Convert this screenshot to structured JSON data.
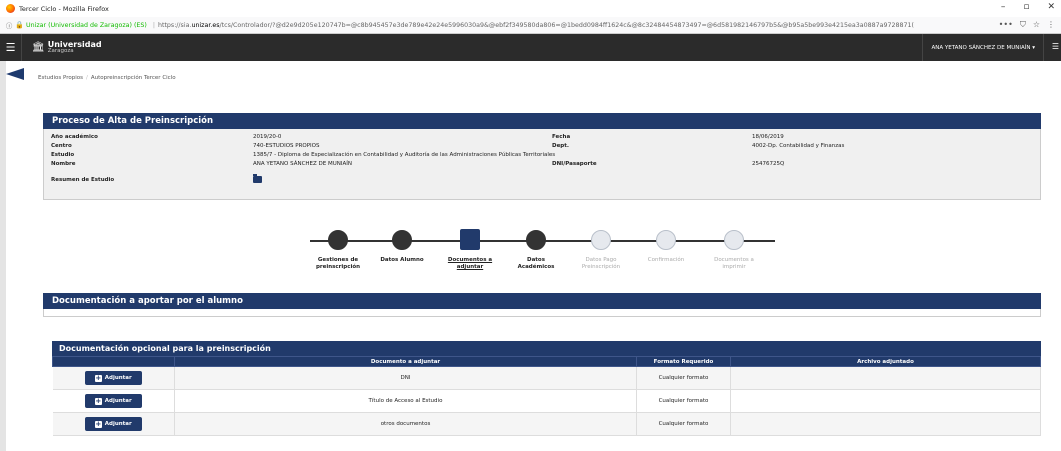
{
  "browser": {
    "window_title": "Tercer Ciclo - Mozilla Firefox",
    "site_identity": "Unizar (Universidad de Zaragoza) (ES)",
    "url_prefix": "https://sia.",
    "url_domain": "unizar.es",
    "url_rest": "/tcs/Controlador/?@d2e9d205e120747b=@c8b945457e3de789e42e24e5996030a9&@ebf2f349580da806=@1bedd0984ff1624c&@8c32484454873497=@6d581982146797b5&@b95a5be993e4215ea3a0887a9728871(",
    "minimize_glyph": "–",
    "maximize_glyph": "▫",
    "close_glyph": "✕"
  },
  "app": {
    "logo_line1": "Universidad",
    "logo_line2": "Zaragoza",
    "user_name": "ANA YETANO SÁNCHEZ DE MUNIAÍN ▾"
  },
  "breadcrumb": [
    "Estudios Propios",
    "Autopreinscripción Tercer Ciclo"
  ],
  "proceso": {
    "title": "Proceso de Alta de Preinscripción",
    "labels": {
      "anio": "Año académico",
      "centro": "Centro",
      "estudio": "Estudio",
      "nombre": "Nombre",
      "resumen": "Resumen de Estudio",
      "fecha": "Fecha",
      "dept": "Dept.",
      "dni": "DNI/Pasaporte"
    },
    "values": {
      "anio": "2019/20-0",
      "centro": "740-ESTUDIOS PROPIOS",
      "estudio": "1385/7 - Diploma de Especialización en Contabilidad y Auditoría de las Administraciones Públicas Territoriales",
      "nombre": "ANA YETANO SÁNCHEZ DE MUNIAÍN",
      "fecha": "18/06/2019",
      "dept": "4002-Dp. Contabilidad y Finanzas",
      "dni": "25476725Q"
    }
  },
  "steps": [
    {
      "line1": "Gestiones de",
      "line2": "preinscripción",
      "state": "done"
    },
    {
      "line1": "Datos Alumno",
      "line2": "",
      "state": "done"
    },
    {
      "line1": "Documentos a",
      "line2": "adjuntar",
      "state": "current"
    },
    {
      "line1": "Datos",
      "line2": "Académicos",
      "state": "done"
    },
    {
      "line1": "Datos Pago",
      "line2": "Preinscripción",
      "state": "todo"
    },
    {
      "line1": "Confirmación",
      "line2": "",
      "state": "todo"
    },
    {
      "line1": "Documentos a",
      "line2": "imprimir",
      "state": "todo"
    }
  ],
  "doc_aportar": {
    "title": "Documentación a aportar por el alumno"
  },
  "doc_opcional": {
    "title": "Documentación opcional para la preinscripción",
    "columns": [
      "",
      "Documento a adjuntar",
      "Formato Requerido",
      "Archivo adjuntado"
    ],
    "button_label": "Adjuntar",
    "rows": [
      {
        "documento": "DNI",
        "formato": "Cualquier formato",
        "archivo": ""
      },
      {
        "documento": "Título de Acceso al Estudio",
        "formato": "Cualquier formato",
        "archivo": ""
      },
      {
        "documento": "otros documentos",
        "formato": "Cualquier formato",
        "archivo": ""
      }
    ]
  },
  "colors": {
    "primary": "#213a6b",
    "appbar": "#2b2b2b",
    "secure_green": "#12bc00"
  }
}
